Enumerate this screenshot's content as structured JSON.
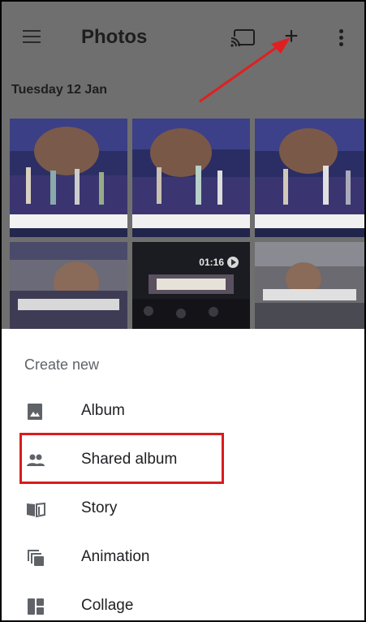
{
  "appbar": {
    "title": "Photos",
    "icons": [
      "menu-icon",
      "cast-icon",
      "add-icon",
      "more-vert-icon"
    ]
  },
  "section": {
    "date": "Tuesday 12 Jan"
  },
  "video": {
    "duration": "01:16"
  },
  "sheet": {
    "title": "Create new",
    "items": [
      {
        "label": "Album",
        "icon": "album-icon"
      },
      {
        "label": "Shared album",
        "icon": "people-icon"
      },
      {
        "label": "Story",
        "icon": "story-icon"
      },
      {
        "label": "Animation",
        "icon": "animation-icon"
      },
      {
        "label": "Collage",
        "icon": "collage-icon"
      }
    ]
  },
  "annotations": {
    "arrow_color": "#e02020",
    "highlight_color": "#d91c1c"
  }
}
